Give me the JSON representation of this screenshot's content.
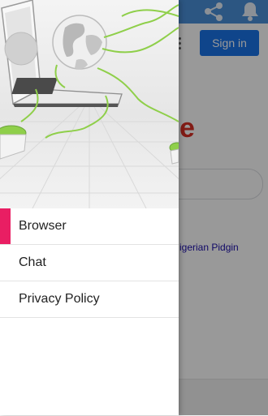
{
  "colors": {
    "accent": "#e91e63",
    "app_bar": "#4a90d9",
    "sign_in": "#1a73e8",
    "logo_red": "#d93025"
  },
  "icons": {
    "share": "share-icon",
    "notifications": "bell-icon",
    "overflow": "more-vert-icon"
  },
  "background_app": {
    "sign_in_label": "Sign in",
    "logo_fragment": "e",
    "language_link": "igerian Pidgin"
  },
  "drawer": {
    "selected_index": 0,
    "items": [
      {
        "label": "Browser"
      },
      {
        "label": "Chat"
      },
      {
        "label": "Privacy Policy"
      }
    ]
  }
}
